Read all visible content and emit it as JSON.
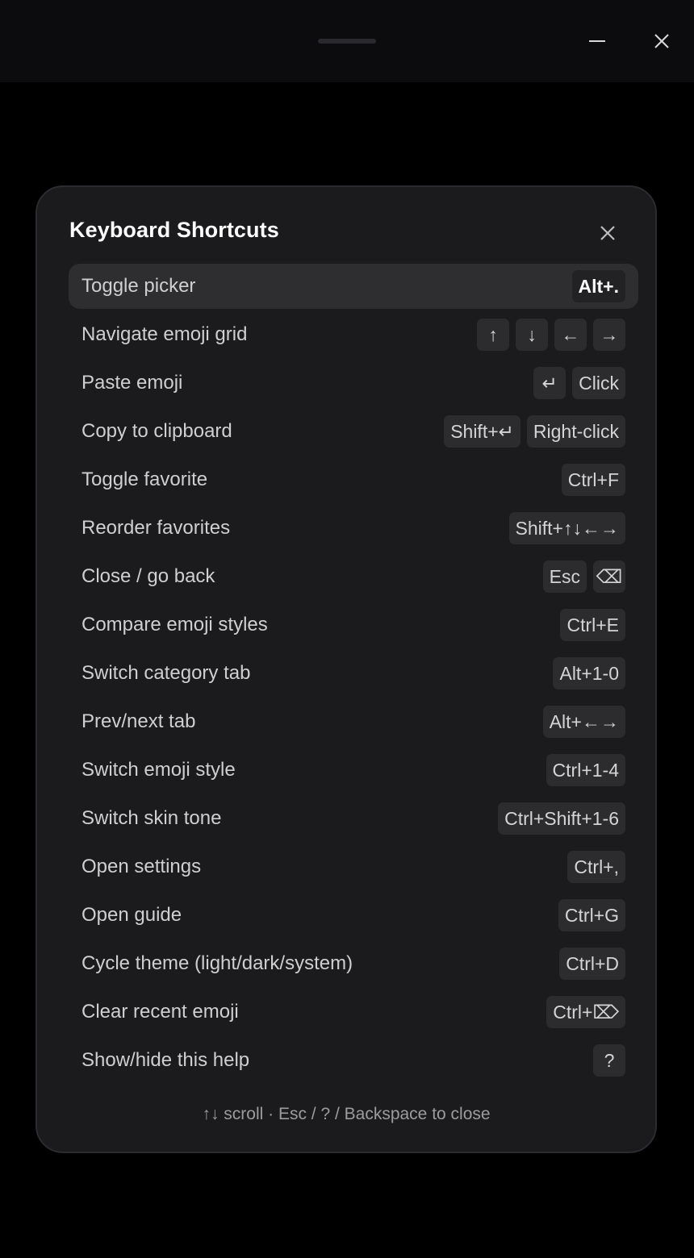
{
  "window": {
    "minimize_icon": "minimize-icon",
    "close_icon": "close-icon"
  },
  "modal": {
    "title": "Keyboard Shortcuts",
    "close_icon": "close-icon",
    "footer": "↑↓ scroll · Esc / ? / Backspace to close"
  },
  "shortcuts": [
    {
      "label": "Toggle picker",
      "keys": [
        "Alt+."
      ]
    },
    {
      "label": "Navigate emoji grid",
      "keys": [
        "↑",
        "↓",
        "←",
        "→"
      ]
    },
    {
      "label": "Paste emoji",
      "keys": [
        "↵",
        "Click"
      ]
    },
    {
      "label": "Copy to clipboard",
      "keys": [
        "Shift+↵",
        "Right-click"
      ]
    },
    {
      "label": "Toggle favorite",
      "keys": [
        "Ctrl+F"
      ]
    },
    {
      "label": "Reorder favorites",
      "keys": [
        "Shift+↑↓←→"
      ]
    },
    {
      "label": "Close / go back",
      "keys": [
        "Esc",
        "⌫"
      ]
    },
    {
      "label": "Compare emoji styles",
      "keys": [
        "Ctrl+E"
      ]
    },
    {
      "label": "Switch category tab",
      "keys": [
        "Alt+1-0"
      ]
    },
    {
      "label": "Prev/next tab",
      "keys": [
        "Alt+←→"
      ]
    },
    {
      "label": "Switch emoji style",
      "keys": [
        "Ctrl+1-4"
      ]
    },
    {
      "label": "Switch skin tone",
      "keys": [
        "Ctrl+Shift+1-6"
      ]
    },
    {
      "label": "Open settings",
      "keys": [
        "Ctrl+,"
      ]
    },
    {
      "label": "Open guide",
      "keys": [
        "Ctrl+G"
      ]
    },
    {
      "label": "Cycle theme (light/dark/system)",
      "keys": [
        "Ctrl+D"
      ]
    },
    {
      "label": "Clear recent emoji",
      "keys": [
        "Ctrl+⌦"
      ]
    },
    {
      "label": "Show/hide this help",
      "keys": [
        "?"
      ]
    }
  ],
  "selected_index": 0,
  "colors": {
    "background": "#000000",
    "panel": "#1b1b1d",
    "selected_row": "#2e2e31",
    "key_cap": "#2c2c2f"
  }
}
